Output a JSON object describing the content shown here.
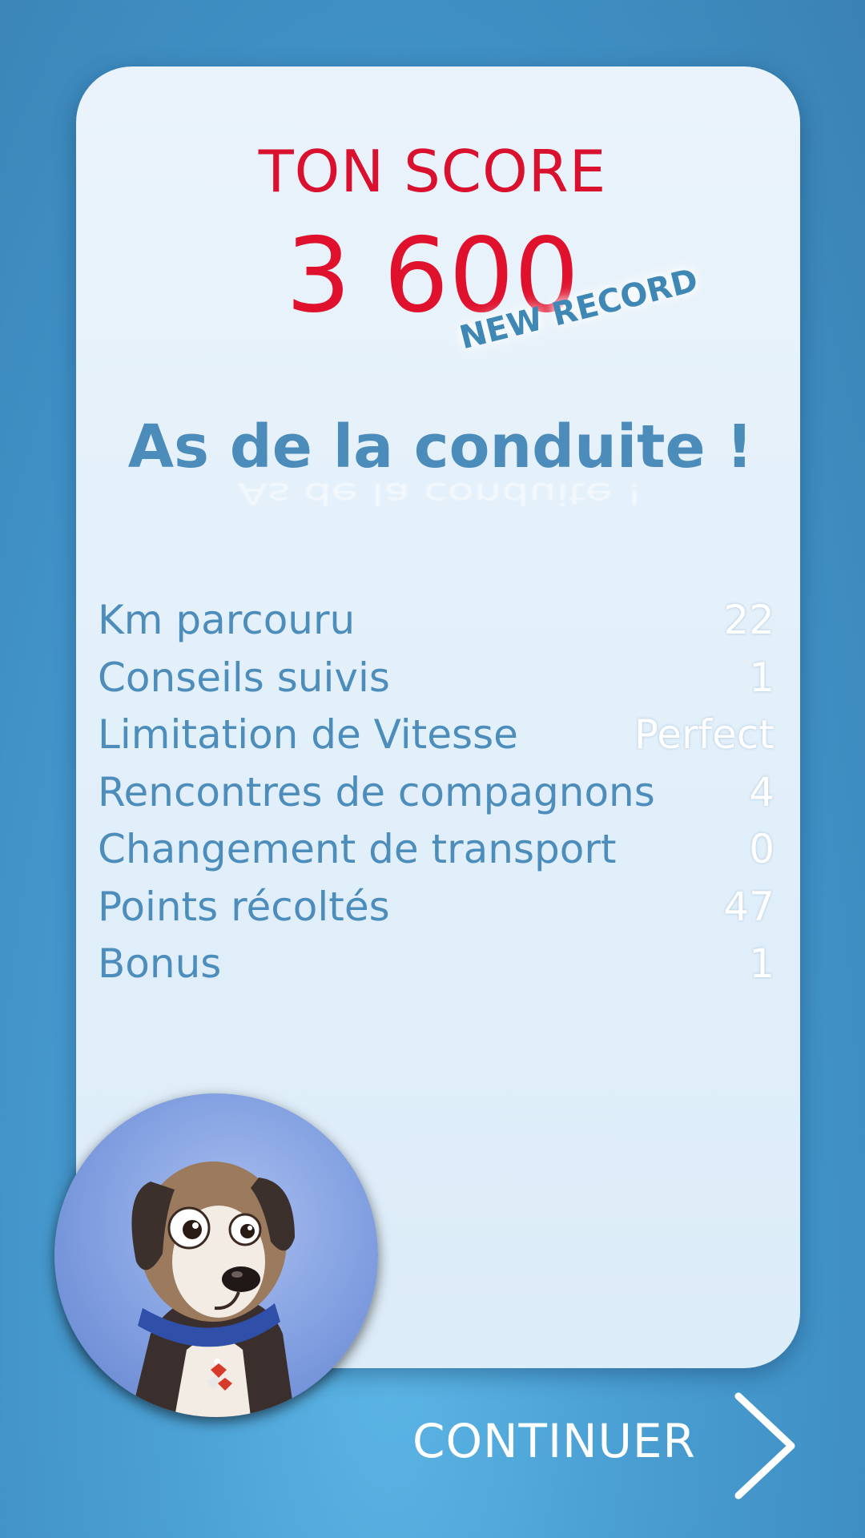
{
  "score": {
    "title": "TON SCORE",
    "value": "3 600",
    "badge": "NEW RECORD"
  },
  "rank": {
    "title": "As de la conduite !",
    "reflection": "As de la conduite !"
  },
  "stats": [
    {
      "label": "Km parcouru",
      "value": "22"
    },
    {
      "label": "Conseils suivis",
      "value": "1"
    },
    {
      "label": "Limitation de Vitesse",
      "value": "Perfect"
    },
    {
      "label": "Rencontres de compagnons",
      "value": "4"
    },
    {
      "label": "Changement de transport",
      "value": "0"
    },
    {
      "label": "Points récoltés",
      "value": "47"
    },
    {
      "label": "Bonus",
      "value": "1"
    }
  ],
  "footer": {
    "continue_label": "CONTINUER"
  },
  "colors": {
    "score_red": "#e0112d",
    "label_blue": "#4d8dbb",
    "background_blue": "#4a9fd3"
  },
  "icons": {
    "mascot": "dog-mascot-icon",
    "next": "chevron-right-icon"
  }
}
